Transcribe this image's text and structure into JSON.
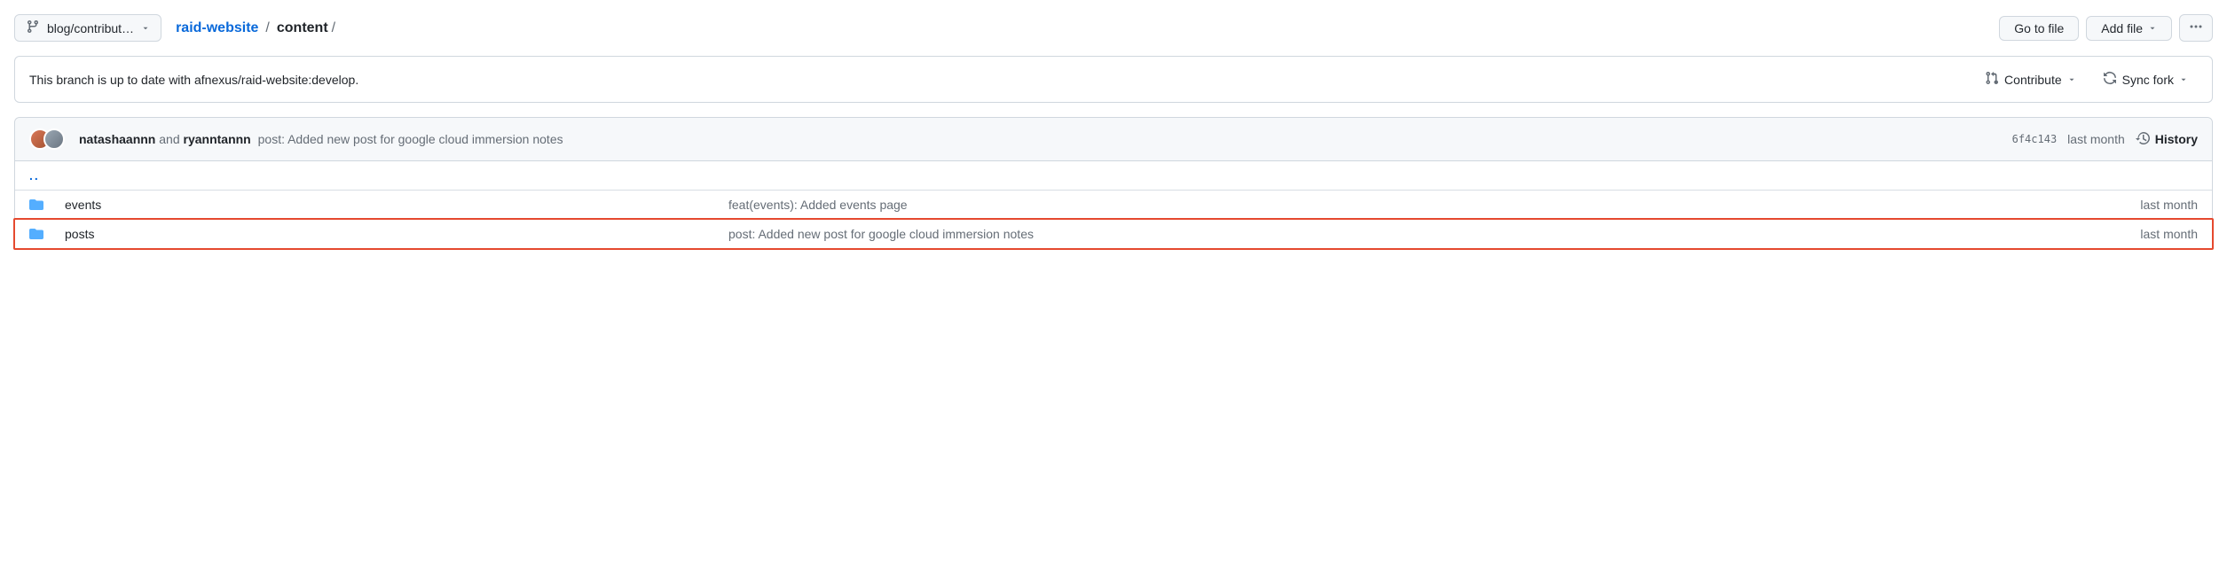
{
  "topbar": {
    "branch_label": "blog/contribut…",
    "breadcrumb": {
      "repo": "raid-website",
      "dir": "content",
      "trail": "/"
    },
    "go_to_file": "Go to file",
    "add_file": "Add file"
  },
  "status": {
    "message": "This branch is up to date with afnexus/raid-website:develop.",
    "contribute": "Contribute",
    "sync_fork": "Sync fork"
  },
  "commit_header": {
    "author1": "natashaannn",
    "joiner": " and ",
    "author2": "ryanntannn",
    "message": " post: Added new post for google cloud immersion notes",
    "sha": "6f4c143",
    "date": "last month",
    "history": "History"
  },
  "updir": "..",
  "rows": [
    {
      "name": "events",
      "msg": "feat(events): Added events page",
      "date": "last month",
      "highlight": false
    },
    {
      "name": "posts",
      "msg": "post: Added new post for google cloud immersion notes",
      "date": "last month",
      "highlight": true
    }
  ]
}
